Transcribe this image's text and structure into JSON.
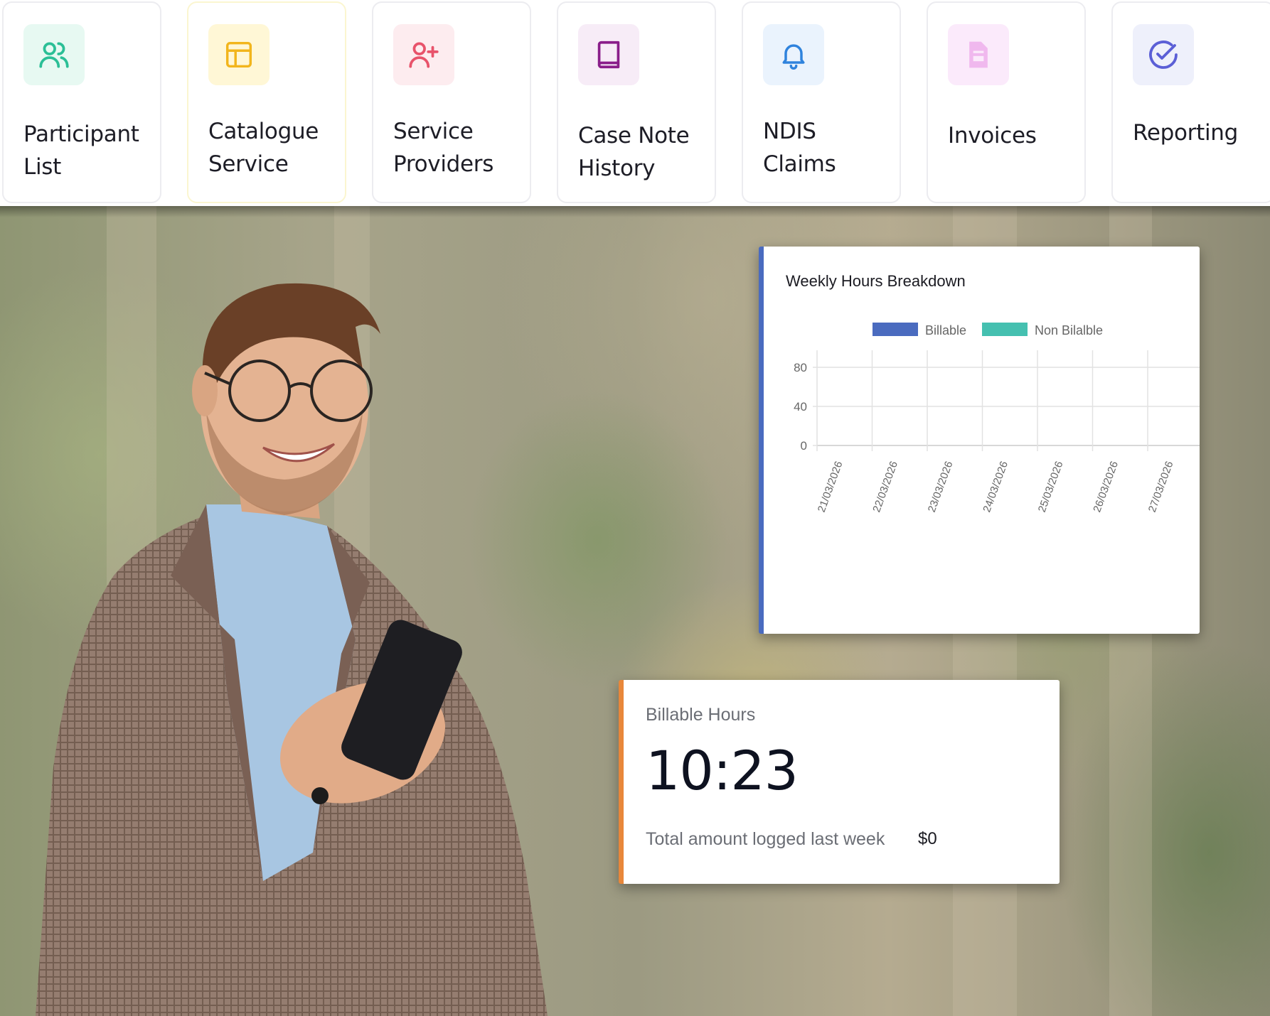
{
  "nav": {
    "items": [
      {
        "label_line1": "Participant",
        "label_line2": "List",
        "icon": "users-icon",
        "icon_bg": "#e7f9f2",
        "icon_color": "#2bbf96"
      },
      {
        "label_line1": "Catalogue",
        "label_line2": "Service",
        "icon": "layout-icon",
        "icon_bg": "#fff7d6",
        "icon_color": "#f2b51c"
      },
      {
        "label_line1": "Service",
        "label_line2": "Providers",
        "icon": "user-plus-icon",
        "icon_bg": "#fdecef",
        "icon_color": "#e8536b"
      },
      {
        "label_line1": "Case Note",
        "label_line2": "History",
        "icon": "book-icon",
        "icon_bg": "#f7ecf7",
        "icon_color": "#8a1e8a"
      },
      {
        "label_line1": "NDIS Claims",
        "label_line2": "",
        "icon": "bell-icon",
        "icon_bg": "#eaf3fd",
        "icon_color": "#2f83dd"
      },
      {
        "label_line1": "Invoices",
        "label_line2": "",
        "icon": "document-icon",
        "icon_bg": "#fbeafb",
        "icon_color": "#f0b8ee"
      },
      {
        "label_line1": "Reporting",
        "label_line2": "",
        "icon": "check-circle-icon",
        "icon_bg": "#eef0fb",
        "icon_color": "#5b5fd6"
      }
    ]
  },
  "chart_data": {
    "type": "bar",
    "title": "Weekly Hours Breakdown",
    "categories": [
      "21/03/2026",
      "22/03/2026",
      "23/03/2026",
      "24/03/2026",
      "25/03/2026",
      "26/03/2026",
      "27/03/2026"
    ],
    "series": [
      {
        "name": "Billable",
        "color": "#4a6bbf",
        "values": [
          0,
          0,
          0,
          0,
          0,
          0,
          0
        ]
      },
      {
        "name": "Non Bilalble",
        "color": "#45c0b0",
        "values": [
          0,
          0,
          0,
          0,
          0,
          0,
          0
        ]
      }
    ],
    "yticks": [
      "80",
      "40",
      "0"
    ],
    "ylim": [
      0,
      80
    ],
    "grid": true,
    "legend": "top"
  },
  "billable": {
    "label": "Billable Hours",
    "value": "10:23",
    "footer_label": "Total amount logged last week",
    "footer_amount": "$0"
  }
}
